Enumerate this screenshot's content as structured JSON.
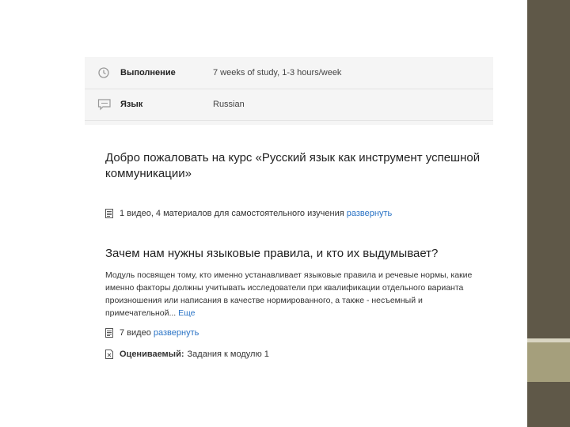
{
  "info": {
    "rows": [
      {
        "label": "Выполнение",
        "value": "7 weeks of study, 1-3 hours/week",
        "icon": "clock-icon"
      },
      {
        "label": "Язык",
        "value": "Russian",
        "icon": "chat-bubble-icon"
      }
    ]
  },
  "course": {
    "module1": {
      "title": "Добро пожаловать на курс «Русский язык как инструмент успешной коммуникации»",
      "meta_text": "1 видео, 4 материалов для самостоятельного изучения",
      "expand_link": "развернуть"
    },
    "module2": {
      "title": "Зачем нам нужны языковые правила, и кто их выдумывает?",
      "description": "Модуль посвящен тому, кто именно устанавливает языковые правила и речевые нормы, какие именно факторы должны учитывать исследователи при квалификации отдельного варианта произношения или написания в качестве нормированного, а также - несъемный и примечательной...",
      "more_link": "Еще",
      "videos_text": "7 видео",
      "expand_link": "развернуть",
      "graded_label": "Оцениваемый:",
      "graded_value": "Задания к модулю 1"
    }
  },
  "colors": {
    "sidebar": "#5f5848",
    "sidebar_band": "#a59f7c",
    "link": "#2a73c5",
    "panel_bg": "#f5f5f5"
  }
}
